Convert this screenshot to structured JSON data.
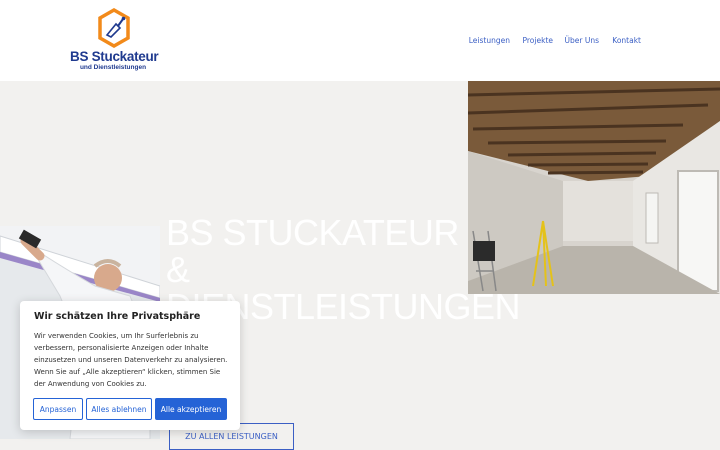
{
  "brand": {
    "name": "BS Stuckateur",
    "tagline": "und Dienstleistungen",
    "primary_color": "#1f3a8f",
    "accent_color": "#f28a1a"
  },
  "nav": {
    "items": [
      {
        "label": "Leistungen"
      },
      {
        "label": "Projekte"
      },
      {
        "label": "Über Uns"
      },
      {
        "label": "Kontakt"
      }
    ]
  },
  "hero": {
    "title_line1": "BS Stuckateur",
    "title_line2": "&",
    "title_line3": "Dienstleistungen",
    "cta_label": "Zu allen Leistungen"
  },
  "cookie_banner": {
    "title": "Wir schätzen Ihre Privatsphäre",
    "text": "Wir verwenden Cookies, um Ihr Surferlebnis zu verbessern, personalisierte Anzeigen oder Inhalte einzusetzen und unseren Datenverkehr zu analysieren. Wenn Sie auf „Alle akzeptieren“ klicken, stimmen Sie der Anwendung von Cookies zu.",
    "customize_label": "Anpassen",
    "reject_label": "Alles ablehnen",
    "accept_label": "Alle akzeptieren"
  },
  "icons": [
    "trowel-icon"
  ]
}
